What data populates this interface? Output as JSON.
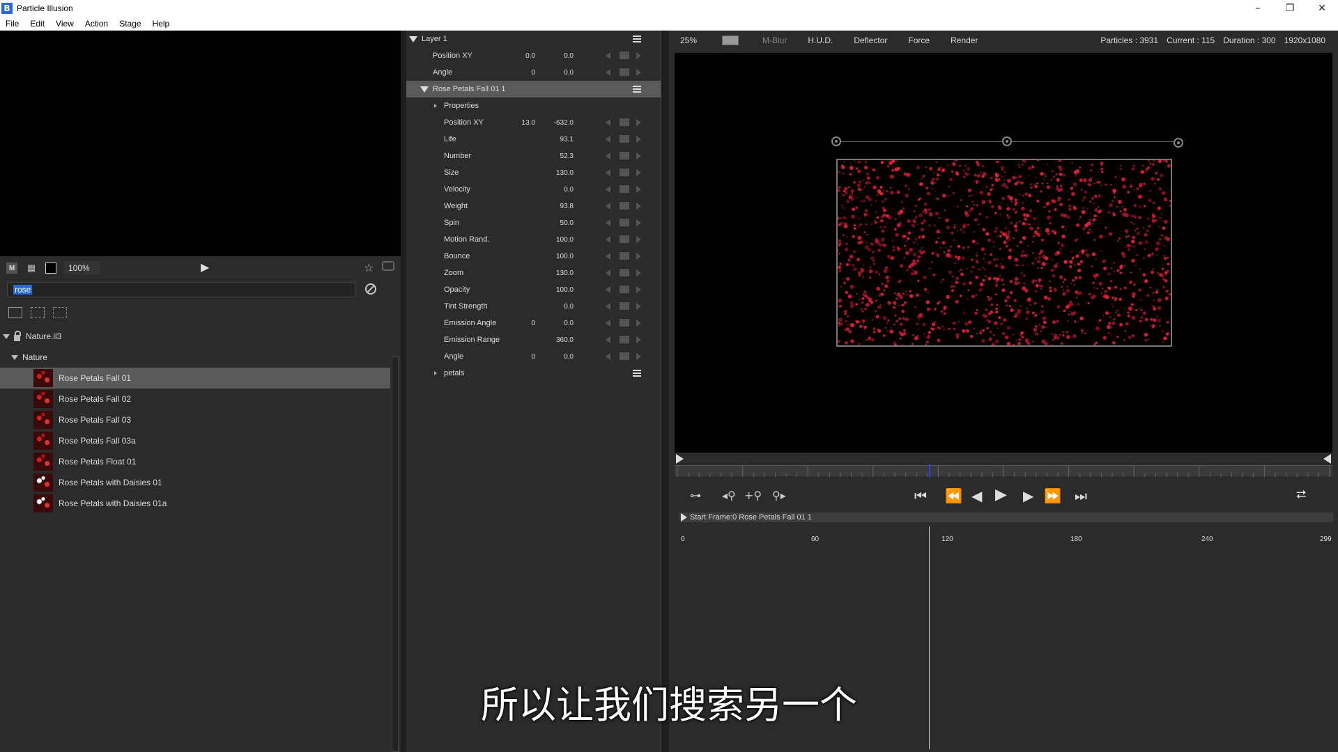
{
  "window": {
    "title": "Particle Illusion",
    "logo_letter": "B",
    "min": "–",
    "max": "❐",
    "close": "✕"
  },
  "menu": [
    "File",
    "Edit",
    "View",
    "Action",
    "Stage",
    "Help"
  ],
  "left": {
    "zoom": "100%",
    "search_value": "rose",
    "tree": {
      "root": "Nature.il3",
      "folder": "Nature",
      "items": [
        {
          "label": "Rose Petals Fall 01",
          "selected": true,
          "thumb": "petals"
        },
        {
          "label": "Rose Petals Fall 02",
          "selected": false,
          "thumb": "petals"
        },
        {
          "label": "Rose Petals Fall 03",
          "selected": false,
          "thumb": "petals"
        },
        {
          "label": "Rose Petals Fall 03a",
          "selected": false,
          "thumb": "petals"
        },
        {
          "label": "Rose Petals Float 01",
          "selected": false,
          "thumb": "petals"
        },
        {
          "label": "Rose Petals with Daisies 01",
          "selected": false,
          "thumb": "daisy"
        },
        {
          "label": "Rose Petals with Daisies 01a",
          "selected": false,
          "thumb": "daisy"
        }
      ]
    }
  },
  "props": {
    "layer": "Layer 1",
    "layer_rows": [
      {
        "label": "Position XY",
        "v1": "0.0",
        "v2": "0.0"
      },
      {
        "label": "Angle",
        "v1": "0",
        "v2": "0.0"
      }
    ],
    "emitter": "Rose Petals Fall 01 1",
    "properties_label": "Properties",
    "emitter_rows": [
      {
        "label": "Position XY",
        "v1": "13.0",
        "v2": "-632.0"
      },
      {
        "label": "Life",
        "v1": "",
        "v2": "93.1"
      },
      {
        "label": "Number",
        "v1": "",
        "v2": "52.3"
      },
      {
        "label": "Size",
        "v1": "",
        "v2": "130.0"
      },
      {
        "label": "Velocity",
        "v1": "",
        "v2": "0.0"
      },
      {
        "label": "Weight",
        "v1": "",
        "v2": "93.8"
      },
      {
        "label": "Spin",
        "v1": "",
        "v2": "50.0"
      },
      {
        "label": "Motion Rand.",
        "v1": "",
        "v2": "100.0"
      },
      {
        "label": "Bounce",
        "v1": "",
        "v2": "100.0"
      },
      {
        "label": "Zoom",
        "v1": "",
        "v2": "130.0"
      },
      {
        "label": "Opacity",
        "v1": "",
        "v2": "100.0"
      },
      {
        "label": "Tint Strength",
        "v1": "",
        "v2": "0.0"
      },
      {
        "label": "Emission Angle",
        "v1": "0",
        "v2": "0.0"
      },
      {
        "label": "Emission Range",
        "v1": "",
        "v2": "360.0"
      },
      {
        "label": "Angle",
        "v1": "0",
        "v2": "0.0"
      }
    ],
    "sub_layer": "petals"
  },
  "viewport": {
    "zoom": "25%",
    "buttons": [
      {
        "label": "M-Blur",
        "dim": true
      },
      {
        "label": "H.U.D.",
        "dim": false
      },
      {
        "label": "Deflector",
        "dim": false
      },
      {
        "label": "Force",
        "dim": false
      },
      {
        "label": "Render",
        "dim": false
      }
    ],
    "particles": "Particles : 3931",
    "current": "Current : 115",
    "duration": "Duration : 300",
    "resolution": "1920x1080",
    "particle_color": "#e0203a"
  },
  "timeline": {
    "track_label": "Start Frame:0 Rose Petals Fall 01 1",
    "ticks": [
      "0",
      "60",
      "120",
      "180",
      "240",
      "299"
    ],
    "current_frame": 115,
    "duration_frames": 300
  },
  "subtitle": "所以让我们搜索另一个"
}
